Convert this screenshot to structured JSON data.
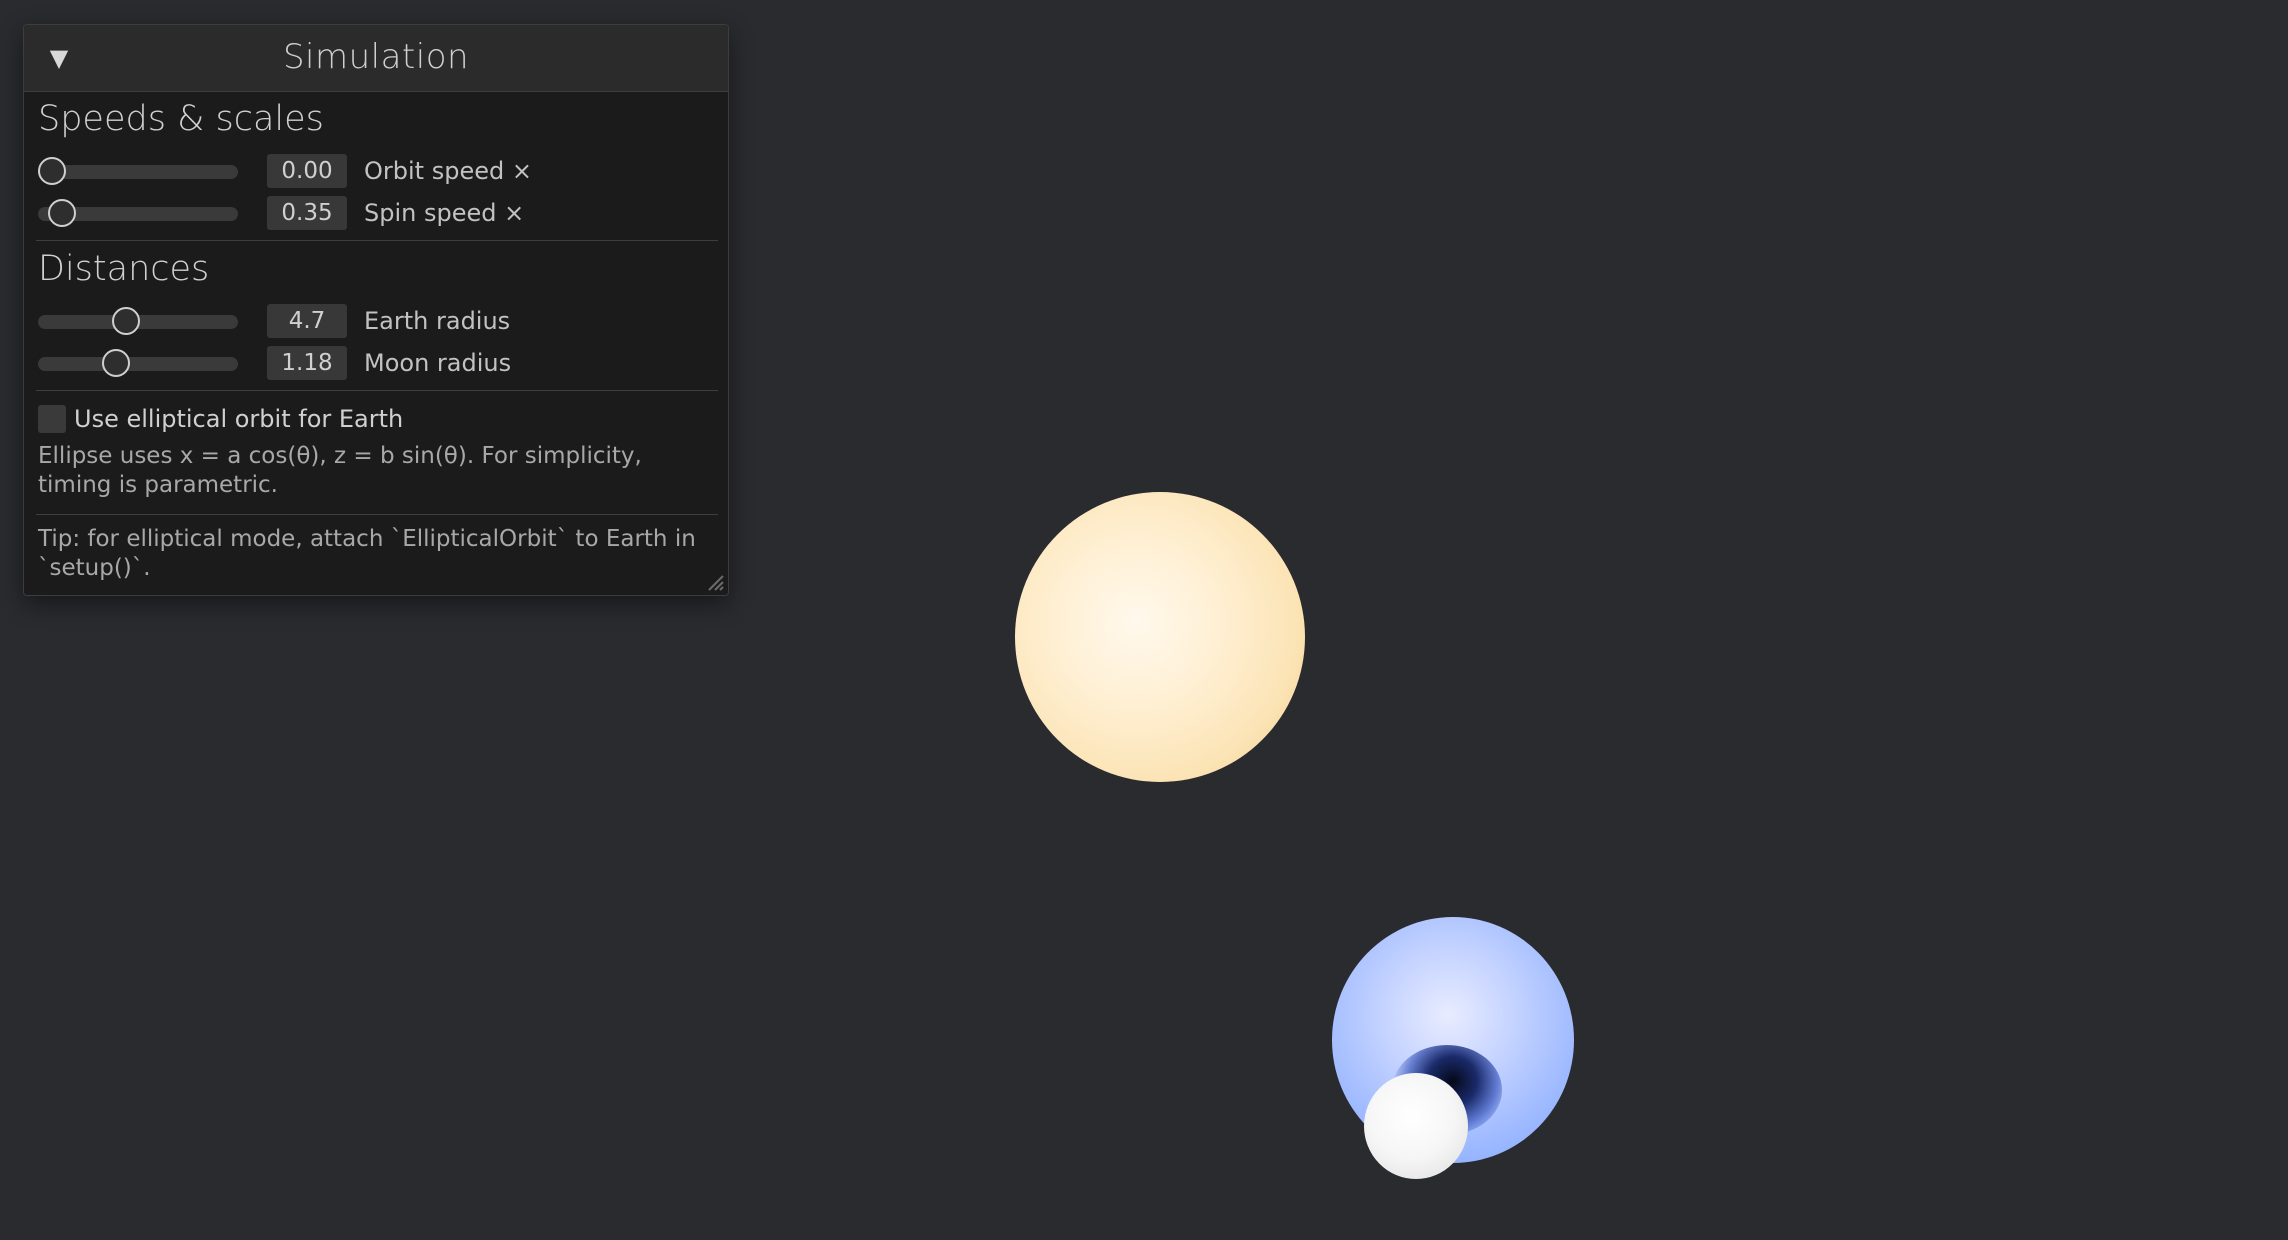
{
  "panel": {
    "collapse_glyph": "▼",
    "title": "Simulation"
  },
  "sections": {
    "speeds_title": "Speeds & scales",
    "distances_title": "Distances"
  },
  "sliders": [
    {
      "id": "orbit-speed",
      "value_text": "0.00",
      "label": "Orbit speed ×",
      "fraction": 0.0
    },
    {
      "id": "spin-speed",
      "value_text": "0.35",
      "label": "Spin speed ×",
      "fraction": 0.06
    },
    {
      "id": "earth-radius",
      "value_text": "4.7",
      "label": "Earth radius",
      "fraction": 0.43
    },
    {
      "id": "moon-radius",
      "value_text": "1.18",
      "label": "Moon radius",
      "fraction": 0.37
    }
  ],
  "elliptical": {
    "checkbox_label": "Use elliptical orbit for Earth",
    "checked": false,
    "note": "Ellipse uses x = a cos(θ), z = b sin(θ). For simplicity, timing is parametric."
  },
  "tip": "Tip: for elliptical mode, attach `EllipticalOrbit` to Earth in `setup()`.",
  "colors": {
    "background": "#2a2b2f",
    "sun": "#fbe3b4",
    "earth": "#9cb8ff",
    "moon": "#f4f4f4"
  }
}
